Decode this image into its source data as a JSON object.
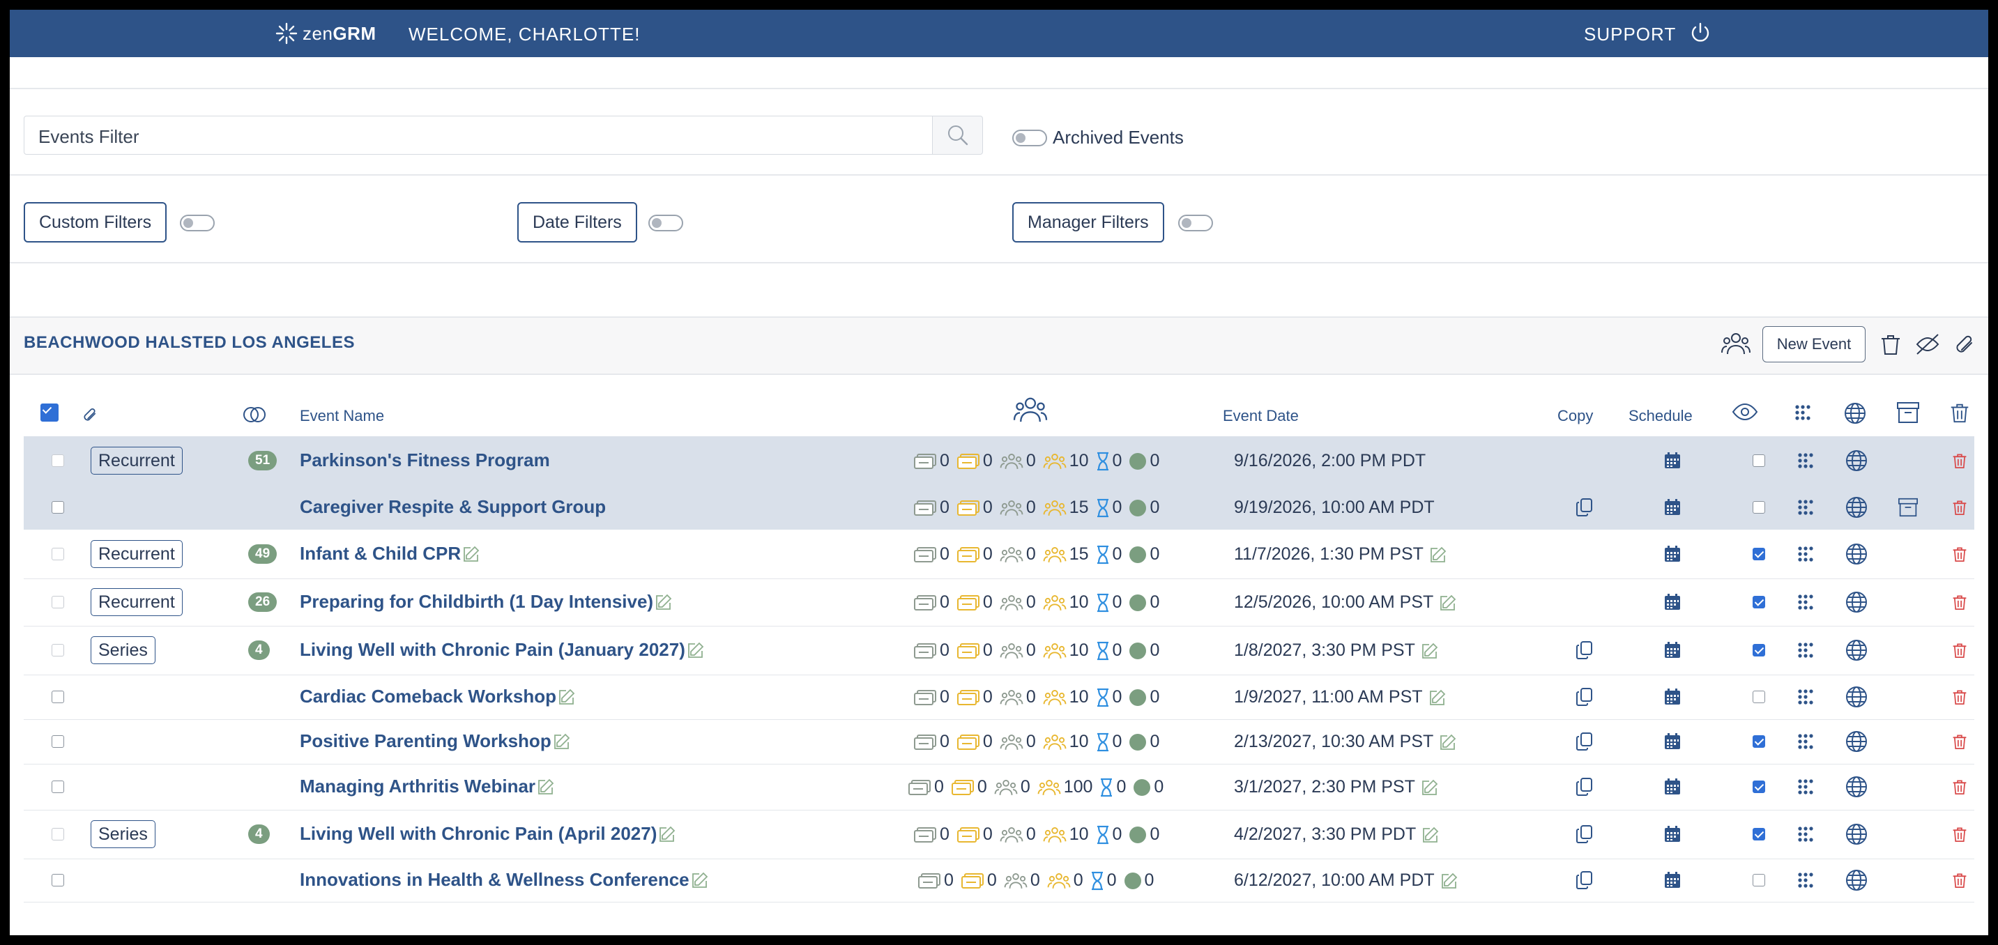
{
  "header": {
    "logo_light": "zen",
    "logo_bold": "GRM",
    "welcome": "WELCOME, CHARLOTTE!",
    "support": "SUPPORT",
    "bar_color": "#2e5388"
  },
  "filters": {
    "events_filter_placeholder": "Events Filter",
    "archived_label": "Archived Events",
    "custom_filters": "Custom Filters",
    "date_filters": "Date Filters",
    "manager_filters": "Manager Filters"
  },
  "section": {
    "location": "BEACHWOOD HALSTED LOS ANGELES",
    "new_event": "New Event"
  },
  "table": {
    "col_event_name": "Event Name",
    "col_event_date": "Event Date",
    "col_copy": "Copy",
    "col_schedule": "Schedule"
  },
  "rows": [
    {
      "tag": "Recurrent",
      "count": "51",
      "name": "Parkinson's Fitness Program",
      "edit": false,
      "s": [
        "0",
        "0",
        "0",
        "10",
        "0",
        "0"
      ],
      "date": "9/16/2026, 2:00 PM PDT",
      "date_edit": false,
      "copy": false,
      "visible": false,
      "archive": false,
      "highlight": true,
      "select_dim": true
    },
    {
      "tag": "",
      "count": "",
      "name": "Caregiver Respite & Support Group",
      "edit": false,
      "s": [
        "0",
        "0",
        "0",
        "15",
        "0",
        "0"
      ],
      "date": "9/19/2026, 10:00 AM PDT",
      "date_edit": false,
      "copy": true,
      "visible": false,
      "archive": true,
      "highlight": true,
      "select_dim": false
    },
    {
      "tag": "Recurrent",
      "count": "49",
      "name": "Infant & Child CPR",
      "edit": true,
      "s": [
        "0",
        "0",
        "0",
        "15",
        "0",
        "0"
      ],
      "date": "11/7/2026, 1:30 PM PST",
      "date_edit": true,
      "copy": false,
      "visible": true,
      "archive": false,
      "highlight": false,
      "select_dim": true
    },
    {
      "tag": "Recurrent",
      "count": "26",
      "name": "Preparing for Childbirth (1 Day Intensive)",
      "edit": true,
      "s": [
        "0",
        "0",
        "0",
        "10",
        "0",
        "0"
      ],
      "date": "12/5/2026, 10:00 AM PST",
      "date_edit": true,
      "copy": false,
      "visible": true,
      "archive": false,
      "highlight": false,
      "select_dim": true
    },
    {
      "tag": "Series",
      "count": "4",
      "name": "Living Well with Chronic Pain (January 2027)",
      "edit": true,
      "s": [
        "0",
        "0",
        "0",
        "10",
        "0",
        "0"
      ],
      "date": "1/8/2027, 3:30 PM PST",
      "date_edit": true,
      "copy": true,
      "visible": true,
      "archive": false,
      "highlight": false,
      "select_dim": true
    },
    {
      "tag": "",
      "count": "",
      "name": "Cardiac Comeback Workshop",
      "edit": true,
      "s": [
        "0",
        "0",
        "0",
        "10",
        "0",
        "0"
      ],
      "date": "1/9/2027, 11:00 AM PST",
      "date_edit": true,
      "copy": true,
      "visible": false,
      "archive": false,
      "highlight": false,
      "select_dim": false
    },
    {
      "tag": "",
      "count": "",
      "name": "Positive Parenting Workshop",
      "edit": true,
      "s": [
        "0",
        "0",
        "0",
        "10",
        "0",
        "0"
      ],
      "date": "2/13/2027, 10:30 AM PST",
      "date_edit": true,
      "copy": true,
      "visible": true,
      "archive": false,
      "highlight": false,
      "select_dim": false
    },
    {
      "tag": "",
      "count": "",
      "name": "Managing Arthritis Webinar",
      "edit": true,
      "s": [
        "0",
        "0",
        "0",
        "100",
        "0",
        "0"
      ],
      "date": "3/1/2027, 2:30 PM PST",
      "date_edit": true,
      "copy": true,
      "visible": true,
      "archive": false,
      "highlight": false,
      "select_dim": false
    },
    {
      "tag": "Series",
      "count": "4",
      "name": "Living Well with Chronic Pain (April 2027)",
      "edit": true,
      "s": [
        "0",
        "0",
        "0",
        "10",
        "0",
        "0"
      ],
      "date": "4/2/2027, 3:30 PM PDT",
      "date_edit": true,
      "copy": true,
      "visible": true,
      "archive": false,
      "highlight": false,
      "select_dim": true
    },
    {
      "tag": "",
      "count": "",
      "name": "Innovations in Health & Wellness Conference",
      "edit": true,
      "s": [
        "0",
        "0",
        "0",
        "0",
        "0",
        "0"
      ],
      "date": "6/12/2027, 10:00 AM PDT",
      "date_edit": true,
      "copy": true,
      "visible": false,
      "archive": false,
      "highlight": false,
      "select_dim": false
    }
  ],
  "icons": {
    "stat_icons": [
      "ticket-gray-icon",
      "ticket-yellow-icon",
      "group-gray-icon",
      "group-yellow-icon",
      "hourglass-icon",
      "green-dot-icon"
    ],
    "colors": {
      "gray": "#8e9a90",
      "yellow": "#e8b730",
      "blue": "#2f8fe0",
      "green": "#7b9e80",
      "red": "#d94a4a",
      "navy": "#2e5388"
    }
  }
}
